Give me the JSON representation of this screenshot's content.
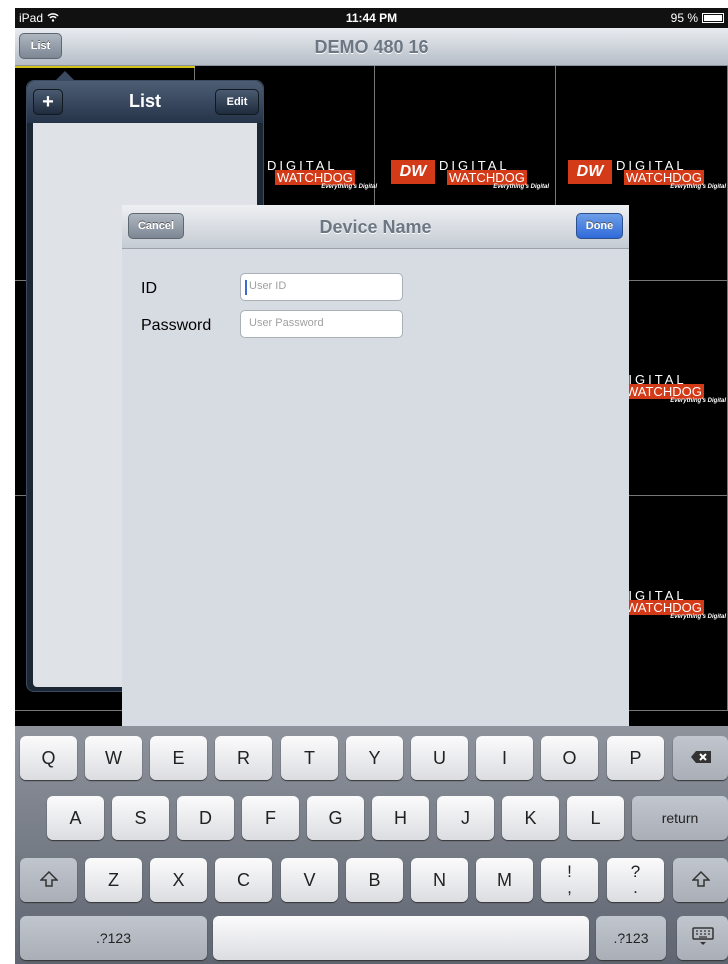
{
  "status_bar": {
    "device": "iPad",
    "wifi_icon": "wifi-icon",
    "time": "11:44 PM",
    "battery": "95 %"
  },
  "nav_bar": {
    "list_button": "List",
    "title": "DEMO 480 16"
  },
  "camera_logo": {
    "brand_mark": "DW",
    "line1": "DIGITAL",
    "line2": "WATCHDOG",
    "tagline": "Everything's Digital"
  },
  "list_popover": {
    "add_label": "+",
    "title": "List",
    "edit_label": "Edit"
  },
  "device_modal": {
    "cancel_label": "Cancel",
    "title": "Device Name",
    "done_label": "Done",
    "id_label": "ID",
    "id_placeholder": "User ID",
    "password_label": "Password",
    "password_placeholder": "User Password"
  },
  "keyboard": {
    "row1": [
      "Q",
      "W",
      "E",
      "R",
      "T",
      "Y",
      "U",
      "I",
      "O",
      "P"
    ],
    "row2": [
      "A",
      "S",
      "D",
      "F",
      "G",
      "H",
      "J",
      "K",
      "L"
    ],
    "row3": [
      "Z",
      "X",
      "C",
      "V",
      "B",
      "N",
      "M"
    ],
    "return_label": "return",
    "numbers_label_left": ".?123",
    "numbers_label_right": ".?123",
    "excl_top": "!",
    "excl_bottom": ",",
    "quest_top": "?",
    "quest_bottom": "."
  }
}
